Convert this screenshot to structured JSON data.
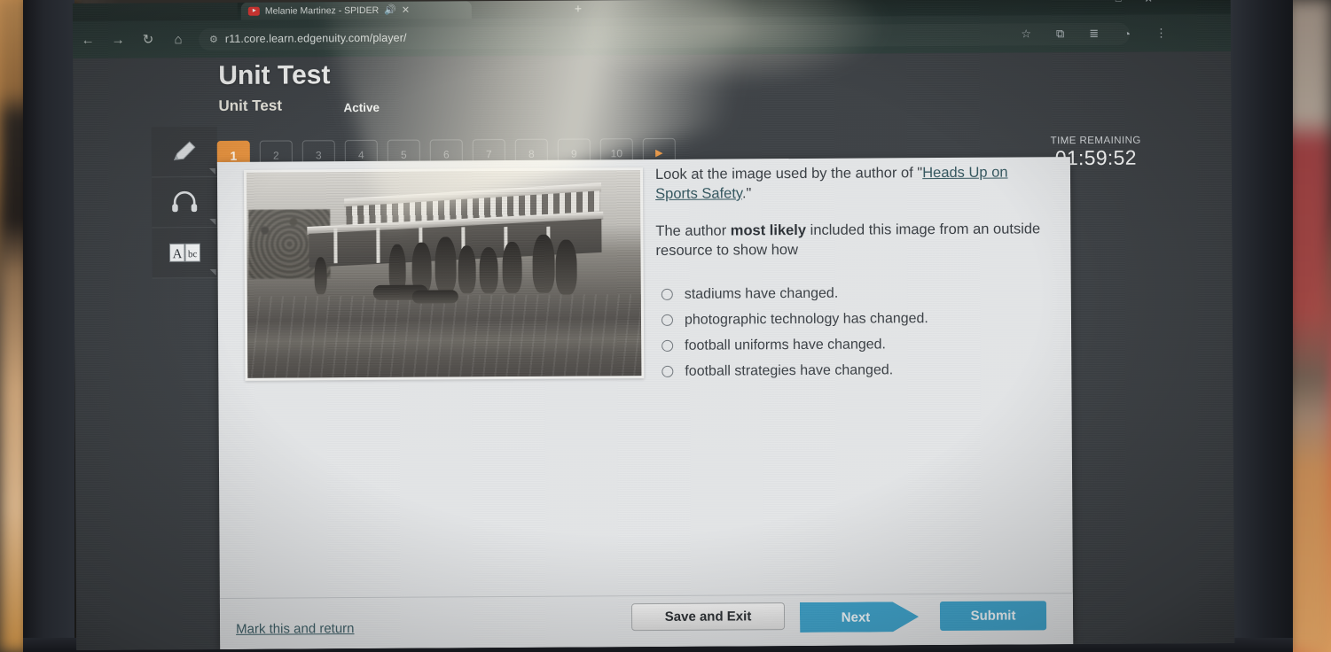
{
  "browser": {
    "tab": {
      "title": "Melanie Martinez - SPIDER",
      "favicon_name": "youtube-icon",
      "audio_icon": "speaker-icon",
      "close_icon": "close-icon"
    },
    "new_tab_label": "+",
    "nav": {
      "back_icon": "back-arrow-icon",
      "forward_icon": "forward-arrow-icon",
      "reload_icon": "reload-icon",
      "home_icon": "home-icon"
    },
    "address": {
      "url": "r11.core.learn.edgenuity.com/player/",
      "permission_icon": "site-permissions-icon"
    },
    "window_controls": {
      "minimize": "—",
      "maximize": "□",
      "close": "✕"
    },
    "toolbar_icons": [
      {
        "name": "favorite-star-icon",
        "glyph": "☆"
      },
      {
        "name": "collections-icon",
        "glyph": "⧉"
      },
      {
        "name": "reading-list-icon",
        "glyph": "≣"
      },
      {
        "name": "profile-avatar-icon",
        "glyph": "◔"
      },
      {
        "name": "browser-menu-icon",
        "glyph": "⋮"
      }
    ]
  },
  "app": {
    "title": "Unit Test",
    "assignment_name": "Unit Test",
    "activity_state": "Active",
    "tools": [
      {
        "name": "highlighter-tool",
        "label": "Highlighter"
      },
      {
        "name": "text-to-speech-tool",
        "label": "Read Aloud"
      },
      {
        "name": "glossary-tool",
        "label": "Glossary"
      }
    ],
    "question_nav": {
      "items": [
        "1",
        "2",
        "3",
        "4",
        "5",
        "6",
        "7",
        "8",
        "9",
        "10"
      ],
      "active": "1",
      "next_arrow_label": "▶"
    },
    "timer": {
      "label": "TIME REMAINING",
      "value": "01:59:52"
    },
    "accent_orange": "#e8933f",
    "accent_blue": "#3fa3cb"
  },
  "question": {
    "stem_prefix": "Look at the image used by the author of \"",
    "stem_link": "Heads Up on Sports Safety",
    "stem_suffix": ".\"",
    "prompt_before": "The author ",
    "prompt_emphasis": "most likely",
    "prompt_after": " included this image from an outside resource to show how",
    "choices": [
      {
        "label": "stadiums have changed.",
        "selected": false
      },
      {
        "label": "photographic technology has changed.",
        "selected": false
      },
      {
        "label": "football uniforms have changed.",
        "selected": false
      },
      {
        "label": "football strategies have changed.",
        "selected": false
      }
    ],
    "image_alt": "Vintage black-and-white photograph of an early football game in front of a wooden grandstand"
  },
  "footer": {
    "mark_link": "Mark this and return",
    "save_exit": "Save and Exit",
    "next": "Next",
    "submit": "Submit"
  }
}
